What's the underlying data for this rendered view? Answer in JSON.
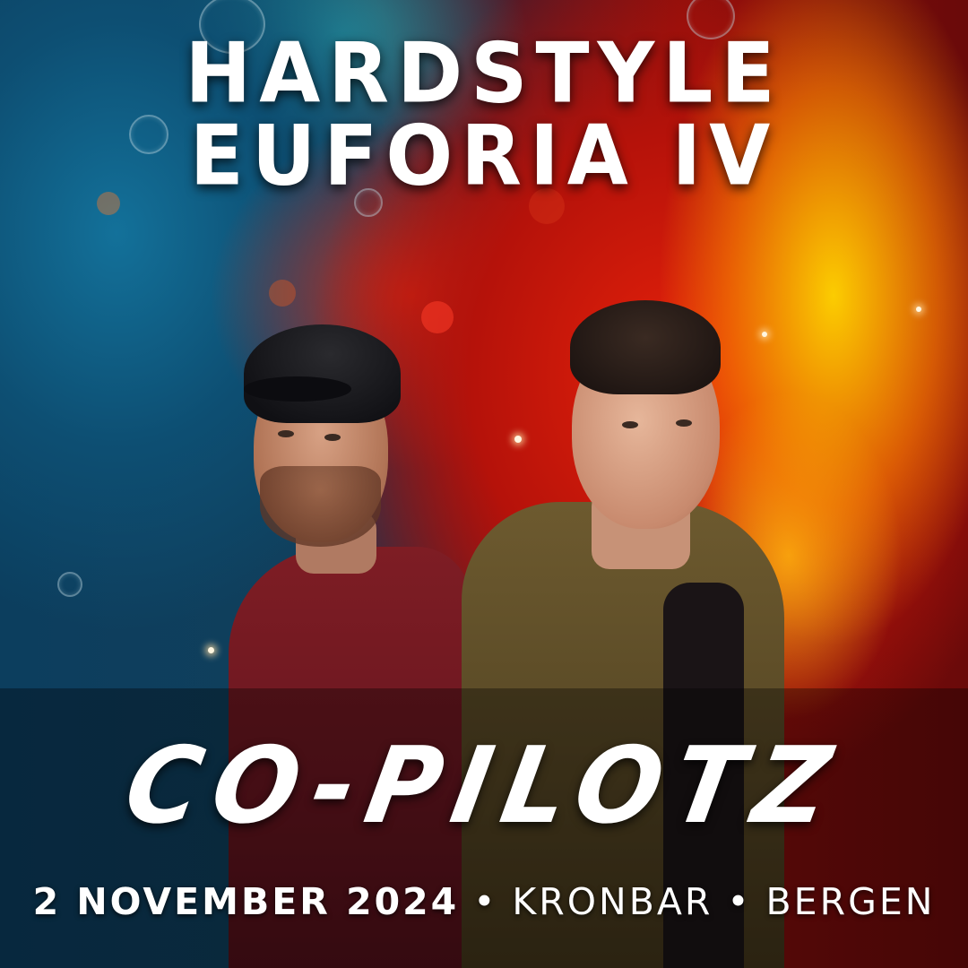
{
  "poster": {
    "title_line1": "HARDSTYLE",
    "title_line2": "EUFORIA IV",
    "artist": "CO-PILOTZ",
    "date": "2 NOVEMBER 2024",
    "separator": "•",
    "venue": "KRONBAR",
    "city": "BERGEN"
  },
  "colors": {
    "background_left": "#0d4f73",
    "background_right": "#e6210a",
    "highlight": "#ffd600",
    "text": "#ffffff"
  }
}
